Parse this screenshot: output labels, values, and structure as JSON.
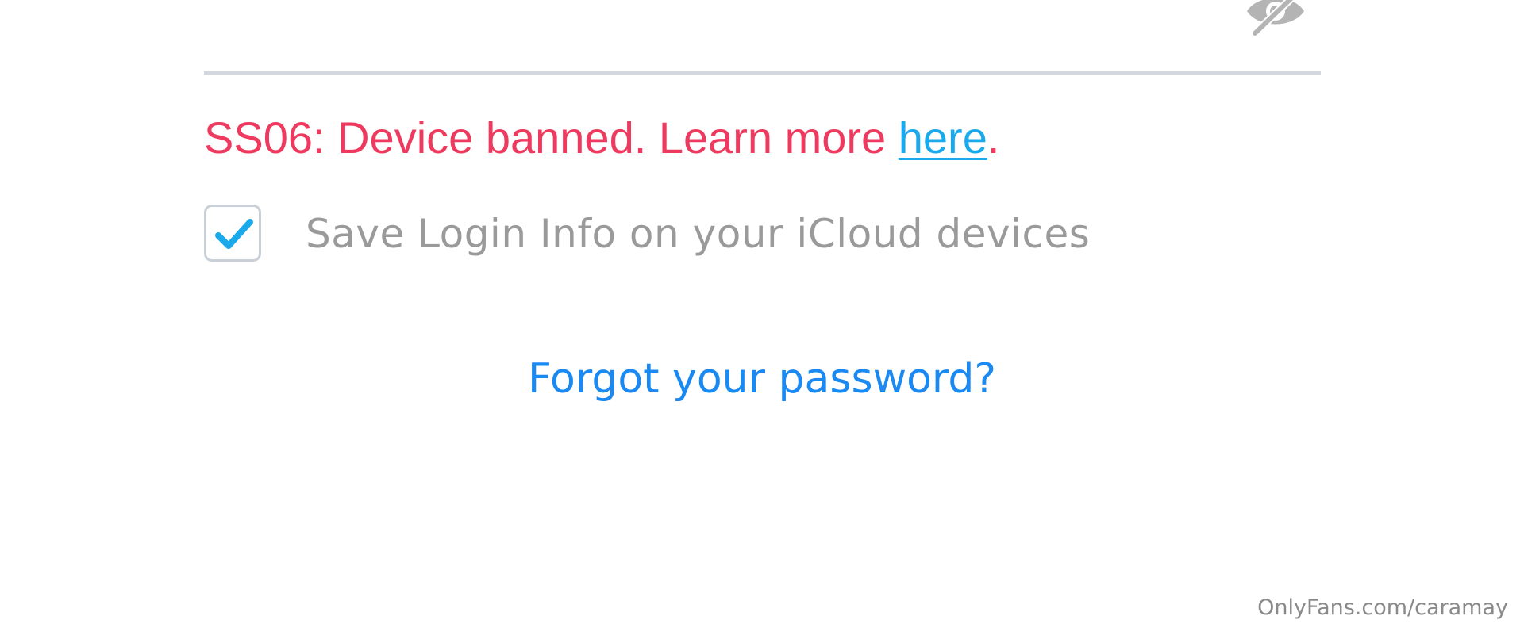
{
  "password_field": {
    "visibility_toggle_icon": "eye-slash-icon"
  },
  "error": {
    "message": "SS06: Device banned. Learn more ",
    "link_label": "here",
    "suffix": ".",
    "text_color": "#ee3a5f",
    "link_color": "#1aa9ea"
  },
  "save_login": {
    "checked": true,
    "label": "Save Login Info on your iCloud devices",
    "check_color": "#1aa9ea"
  },
  "forgot_password": {
    "label": "Forgot your password?",
    "color": "#1a8af2"
  },
  "watermark": {
    "text": "OnlyFans.com/caramay"
  }
}
